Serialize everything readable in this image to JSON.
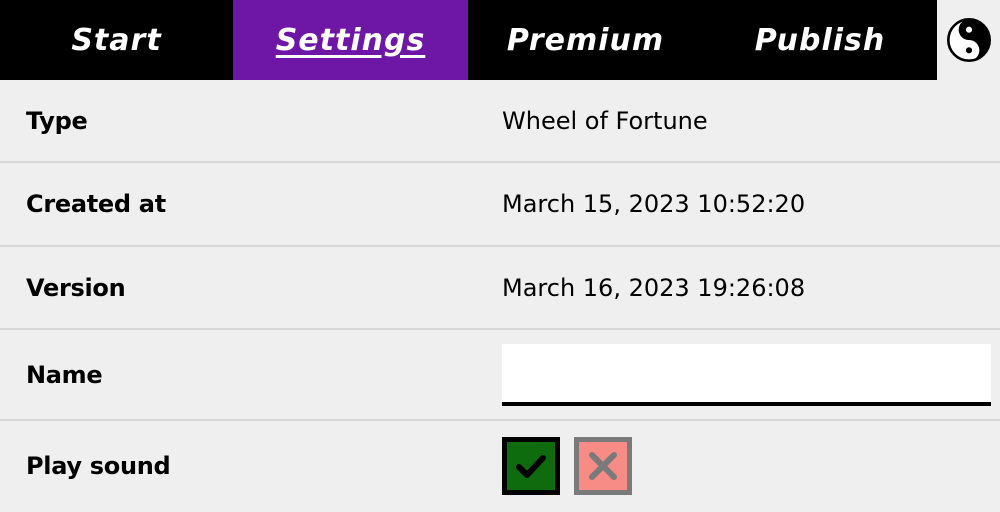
{
  "nav": {
    "tabs": [
      {
        "label": "Start",
        "active": false
      },
      {
        "label": "Settings",
        "active": true
      },
      {
        "label": "Premium",
        "active": false
      },
      {
        "label": "Publish",
        "active": false
      }
    ],
    "theme_icon": "yin-yang-icon",
    "active_color": "#6e16a6"
  },
  "settings": {
    "type": {
      "label": "Type",
      "value": "Wheel of Fortune"
    },
    "created_at": {
      "label": "Created at",
      "value": "March 15, 2023 10:52:20"
    },
    "version": {
      "label": "Version",
      "value": "March 16, 2023 19:26:08"
    },
    "name": {
      "label": "Name",
      "value": "",
      "placeholder": ""
    },
    "play_sound": {
      "label": "Play sound",
      "value": true,
      "yes_icon": "checkmark-icon",
      "no_icon": "x-icon",
      "yes_color": "#0e6b0e",
      "no_color": "#f78b85"
    }
  }
}
